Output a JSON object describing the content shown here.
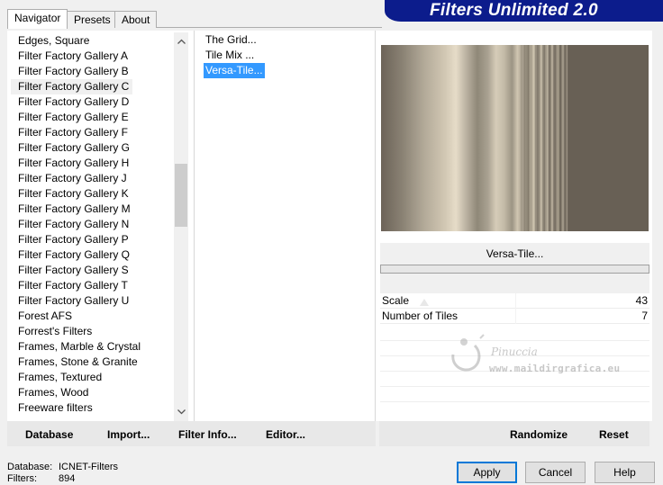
{
  "tabs": [
    {
      "label": "Navigator",
      "active": true
    },
    {
      "label": "Presets",
      "active": false
    },
    {
      "label": "About",
      "active": false
    }
  ],
  "banner": {
    "title": "Filters Unlimited 2.0",
    "color": "#0c1c8c"
  },
  "categories": {
    "items": [
      "Edges, Square",
      "Filter Factory Gallery A",
      "Filter Factory Gallery B",
      "Filter Factory Gallery C",
      "Filter Factory Gallery D",
      "Filter Factory Gallery E",
      "Filter Factory Gallery F",
      "Filter Factory Gallery G",
      "Filter Factory Gallery H",
      "Filter Factory Gallery J",
      "Filter Factory Gallery K",
      "Filter Factory Gallery M",
      "Filter Factory Gallery N",
      "Filter Factory Gallery P",
      "Filter Factory Gallery Q",
      "Filter Factory Gallery S",
      "Filter Factory Gallery T",
      "Filter Factory Gallery U",
      "Forest AFS",
      "Forrest's Filters",
      "Frames, Marble & Crystal",
      "Frames, Stone & Granite",
      "Frames, Textured",
      "Frames, Wood",
      "Freeware filters"
    ],
    "selected_index": 3
  },
  "filters": {
    "items": [
      "The Grid...",
      "Tile Mix ...",
      "Versa-Tile..."
    ],
    "selected_index": 2
  },
  "settings": {
    "filter_name": "Versa-Tile...",
    "params": [
      {
        "label": "Scale",
        "value": "43"
      },
      {
        "label": "Number of Tiles",
        "value": "7"
      }
    ]
  },
  "watermark": {
    "name": "Pinuccia",
    "url": "www.maildirgrafica.eu"
  },
  "toolbar": {
    "database": "Database",
    "import": "Import...",
    "filter_info": "Filter Info...",
    "editor": "Editor...",
    "randomize": "Randomize",
    "reset": "Reset"
  },
  "status": {
    "database_label": "Database:",
    "database_value": "ICNET-Filters",
    "filters_label": "Filters:",
    "filters_value": "894"
  },
  "buttons": {
    "apply": "Apply",
    "cancel": "Cancel",
    "help": "Help"
  }
}
